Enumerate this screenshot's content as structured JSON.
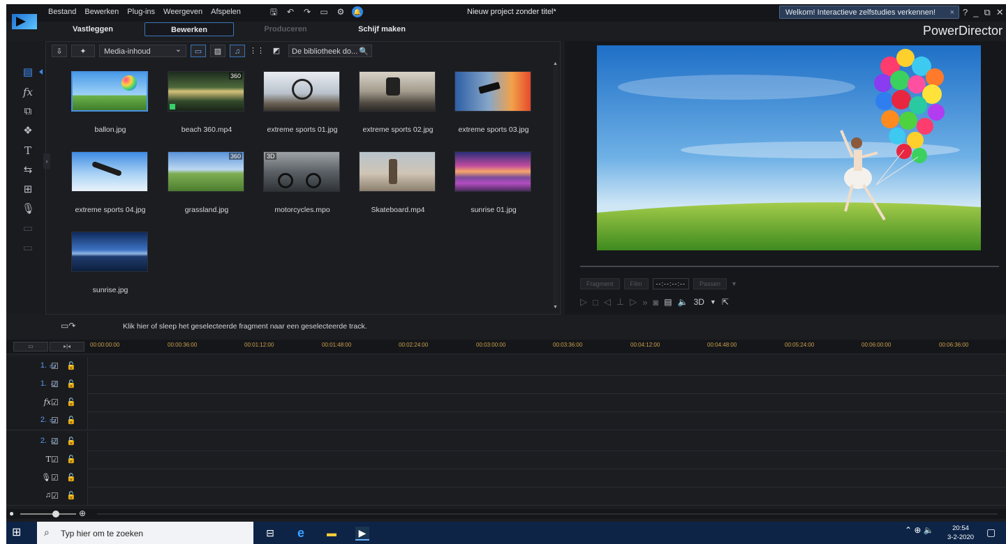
{
  "menu": [
    "Bestand",
    "Bewerken",
    "Plug-ins",
    "Weergeven",
    "Afspelen"
  ],
  "window": {
    "title": "Nieuw project zonder titel*",
    "brand": "PowerDirector"
  },
  "welcome": {
    "text": "Welkom! Interactieve zelfstudies verkennen!",
    "close": "×"
  },
  "window_buttons": [
    "?",
    "_",
    "⧉",
    "✕"
  ],
  "modes": [
    {
      "label": "Vastleggen",
      "state": "normal"
    },
    {
      "label": "Bewerken",
      "state": "active"
    },
    {
      "label": "Produceren",
      "state": "disabled"
    },
    {
      "label": "Schijf maken",
      "state": "normal"
    }
  ],
  "library": {
    "filter": "Media-inhoud",
    "search_placeholder": "De bibliotheek do...",
    "items": [
      {
        "name": "ballon.jpg",
        "tag": "",
        "selected": true
      },
      {
        "name": "beach 360.mp4",
        "tag": "360"
      },
      {
        "name": "extreme sports 01.jpg",
        "tag": ""
      },
      {
        "name": "extreme sports 02.jpg",
        "tag": ""
      },
      {
        "name": "extreme sports 03.jpg",
        "tag": ""
      },
      {
        "name": "extreme sports 04.jpg",
        "tag": ""
      },
      {
        "name": "grassland.jpg",
        "tag": "360"
      },
      {
        "name": "motorcycles.mpo",
        "tag": "3D"
      },
      {
        "name": "Skateboard.mp4",
        "tag": ""
      },
      {
        "name": "sunrise 01.jpg",
        "tag": ""
      },
      {
        "name": "sunrise.jpg",
        "tag": ""
      }
    ]
  },
  "preview": {
    "fragment_label": "Fragment",
    "film_label": "Film",
    "timecode": "--:--:--:--",
    "fit_label": "Passen",
    "three_d": "3D"
  },
  "timeline": {
    "hint": "Klik hier of sleep het geselecteerde fragment naar een geselecteerde track.",
    "ticks": [
      "00:00:00:00",
      "00:00:36:00",
      "00:01:12:00",
      "00:01:48:00",
      "00:02:24:00",
      "00:03:00:00",
      "00:03:36:00",
      "00:04:12:00",
      "00:04:48:00",
      "00:05:24:00",
      "00:06:00:00",
      "00:06:36:00"
    ],
    "tracks": [
      {
        "label": "1.",
        "icon": "video-track-icon"
      },
      {
        "label": "1.",
        "icon": "audio-track-icon"
      },
      {
        "label": "fx",
        "icon": "fx-track-icon"
      },
      {
        "label": "2.",
        "icon": "video-track-icon"
      },
      {
        "label": "2.",
        "icon": "audio-track-icon"
      },
      {
        "label": "T",
        "icon": "title-track-icon"
      },
      {
        "label": "🎙",
        "icon": "voice-track-icon"
      },
      {
        "label": "♫",
        "icon": "music-track-icon"
      }
    ]
  },
  "taskbar": {
    "search_placeholder": "Typ hier om te zoeken",
    "time": "20:54",
    "date": "3-2-2020"
  },
  "colors": {
    "accent": "#3d8cf0",
    "background": "#1c1d21",
    "taskbar": "#0d2447",
    "ruler_ticks": "#c9a24a"
  }
}
